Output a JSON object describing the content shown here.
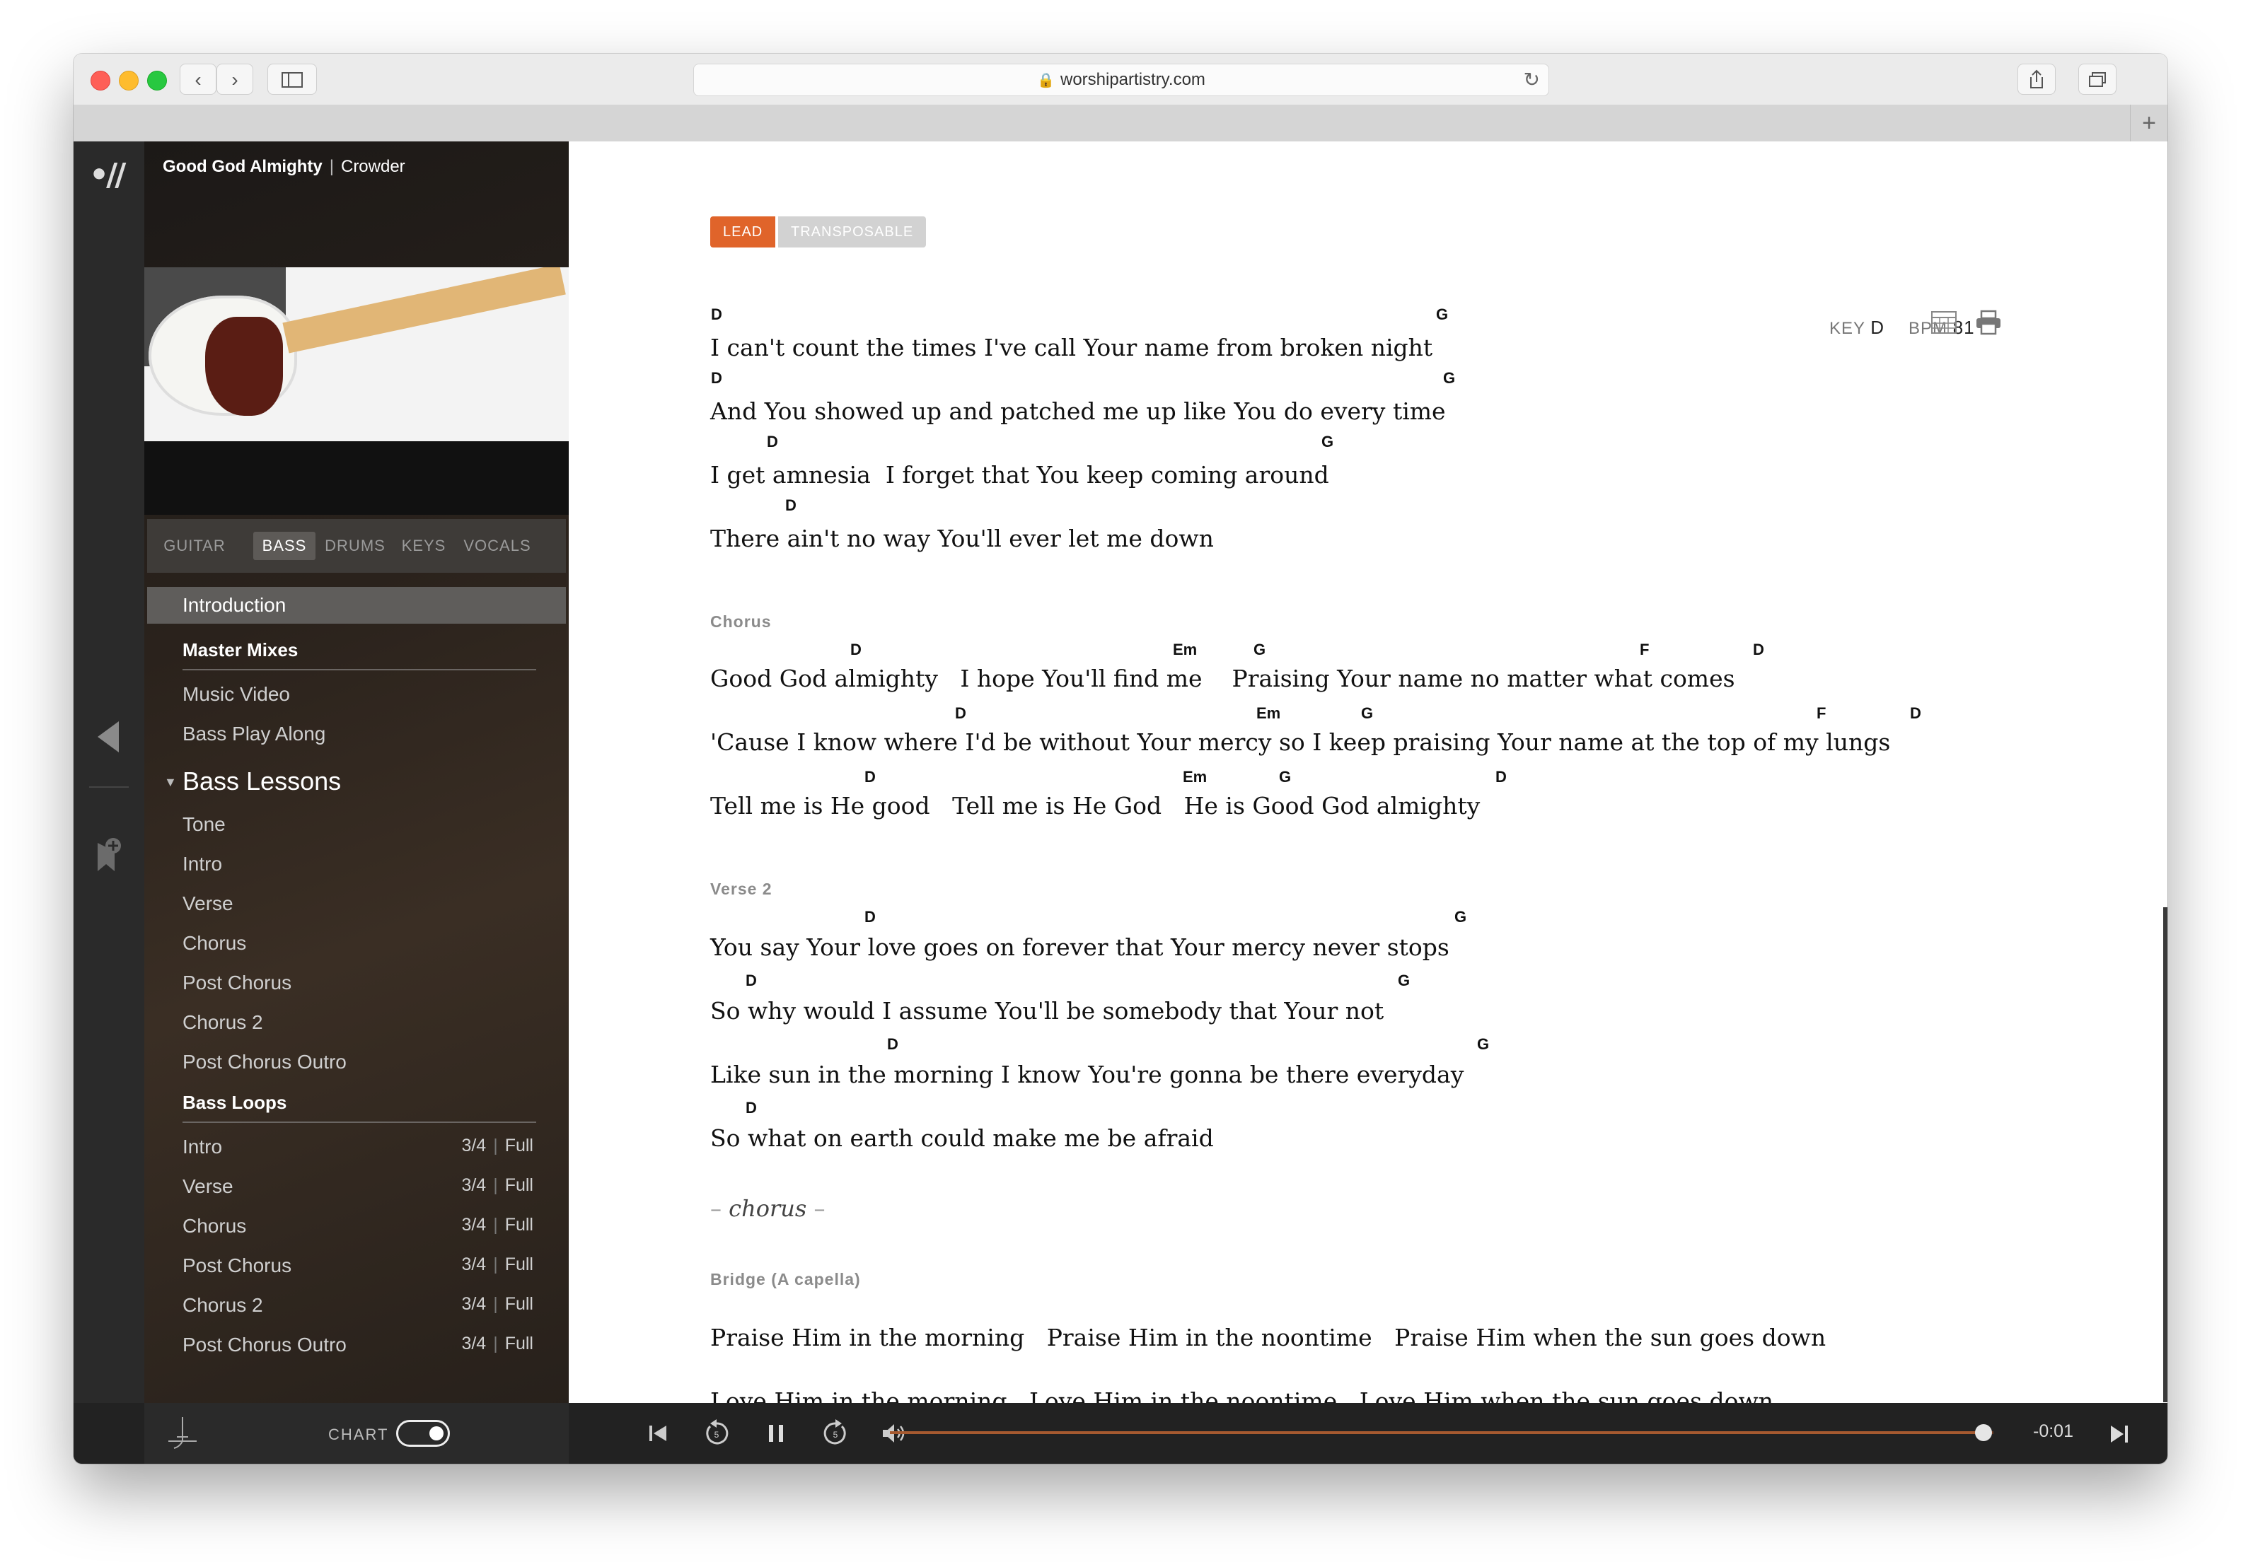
{
  "browser": {
    "url": "worshipartistry.com"
  },
  "song": {
    "title": "Good God Almighty",
    "artist": "Crowder"
  },
  "instrument_tabs": [
    "GUITAR",
    "BASS",
    "DRUMS",
    "KEYS",
    "VOCALS"
  ],
  "menu": {
    "introduction": "Introduction",
    "master_mixes": "Master Mixes",
    "mixes": [
      "Music Video",
      "Bass Play Along"
    ],
    "lessons_title": "Bass Lessons",
    "lessons": [
      "Tone",
      "Intro",
      "Verse",
      "Chorus",
      "Post Chorus",
      "Chorus 2",
      "Post Chorus Outro"
    ],
    "loops_title": "Bass Loops",
    "loops": [
      {
        "name": "Intro",
        "tempo": "3/4",
        "mode": "Full"
      },
      {
        "name": "Verse",
        "tempo": "3/4",
        "mode": "Full"
      },
      {
        "name": "Chorus",
        "tempo": "3/4",
        "mode": "Full"
      },
      {
        "name": "Post Chorus",
        "tempo": "3/4",
        "mode": "Full"
      },
      {
        "name": "Chorus 2",
        "tempo": "3/4",
        "mode": "Full"
      },
      {
        "name": "Post Chorus Outro",
        "tempo": "3/4",
        "mode": "Full"
      }
    ]
  },
  "chart": {
    "badge_lead": "LEAD",
    "badge_transposable": "TRANSPOSABLE",
    "key_label": "KEY",
    "key_value": "D",
    "bpm_label": "BPM",
    "bpm_value": "81",
    "verse1_lines": [
      "I can't count the times I've call Your name from broken night",
      "And You showed up and patched me up like You do every time",
      "I get amnesia  I forget that You keep coming around",
      "There ain't no way You'll ever let me down"
    ],
    "verse1_chords": [
      [
        "D",
        "G"
      ],
      [
        "D",
        "G"
      ],
      [
        "D",
        "G"
      ],
      [
        "D"
      ]
    ],
    "chorus_label": "Chorus",
    "chorus_lines": [
      "Good God almighty   I hope You'll find me    Praising Your name no matter what comes",
      "'Cause I know where I'd be without Your mercy so I keep praising Your name at the top of my lungs",
      "Tell me is He good   Tell me is He God   He is Good God almighty"
    ],
    "chorus_chords": [
      [
        "D",
        "Em",
        "G",
        "F",
        "D"
      ],
      [
        "D",
        "Em",
        "G",
        "F",
        "D"
      ],
      [
        "D",
        "Em",
        "G",
        "D"
      ]
    ],
    "verse2_label": "Verse 2",
    "verse2_lines": [
      "You say Your love goes on forever that Your mercy never stops",
      "So why would I assume You'll be somebody that Your not",
      "Like sun in the morning I know You're gonna be there everyday",
      "So what on earth could make me be afraid"
    ],
    "verse2_chords": [
      [
        "D",
        "G"
      ],
      [
        "D",
        "G"
      ],
      [
        "D",
        "G"
      ],
      [
        "D"
      ]
    ],
    "repeat": "chorus",
    "bridge_label": "Bridge (A capella)",
    "bridge_lines": [
      "Praise Him in the morning   Praise Him in the noontime   Praise Him when the sun goes down",
      "Love Him in the morning   Love Him in the noontime   Love Him when the sun goes down"
    ]
  },
  "player": {
    "chart_label": "CHART",
    "chart_toggle_on": true,
    "time_remaining": "-0:01",
    "progress": 0.985
  }
}
